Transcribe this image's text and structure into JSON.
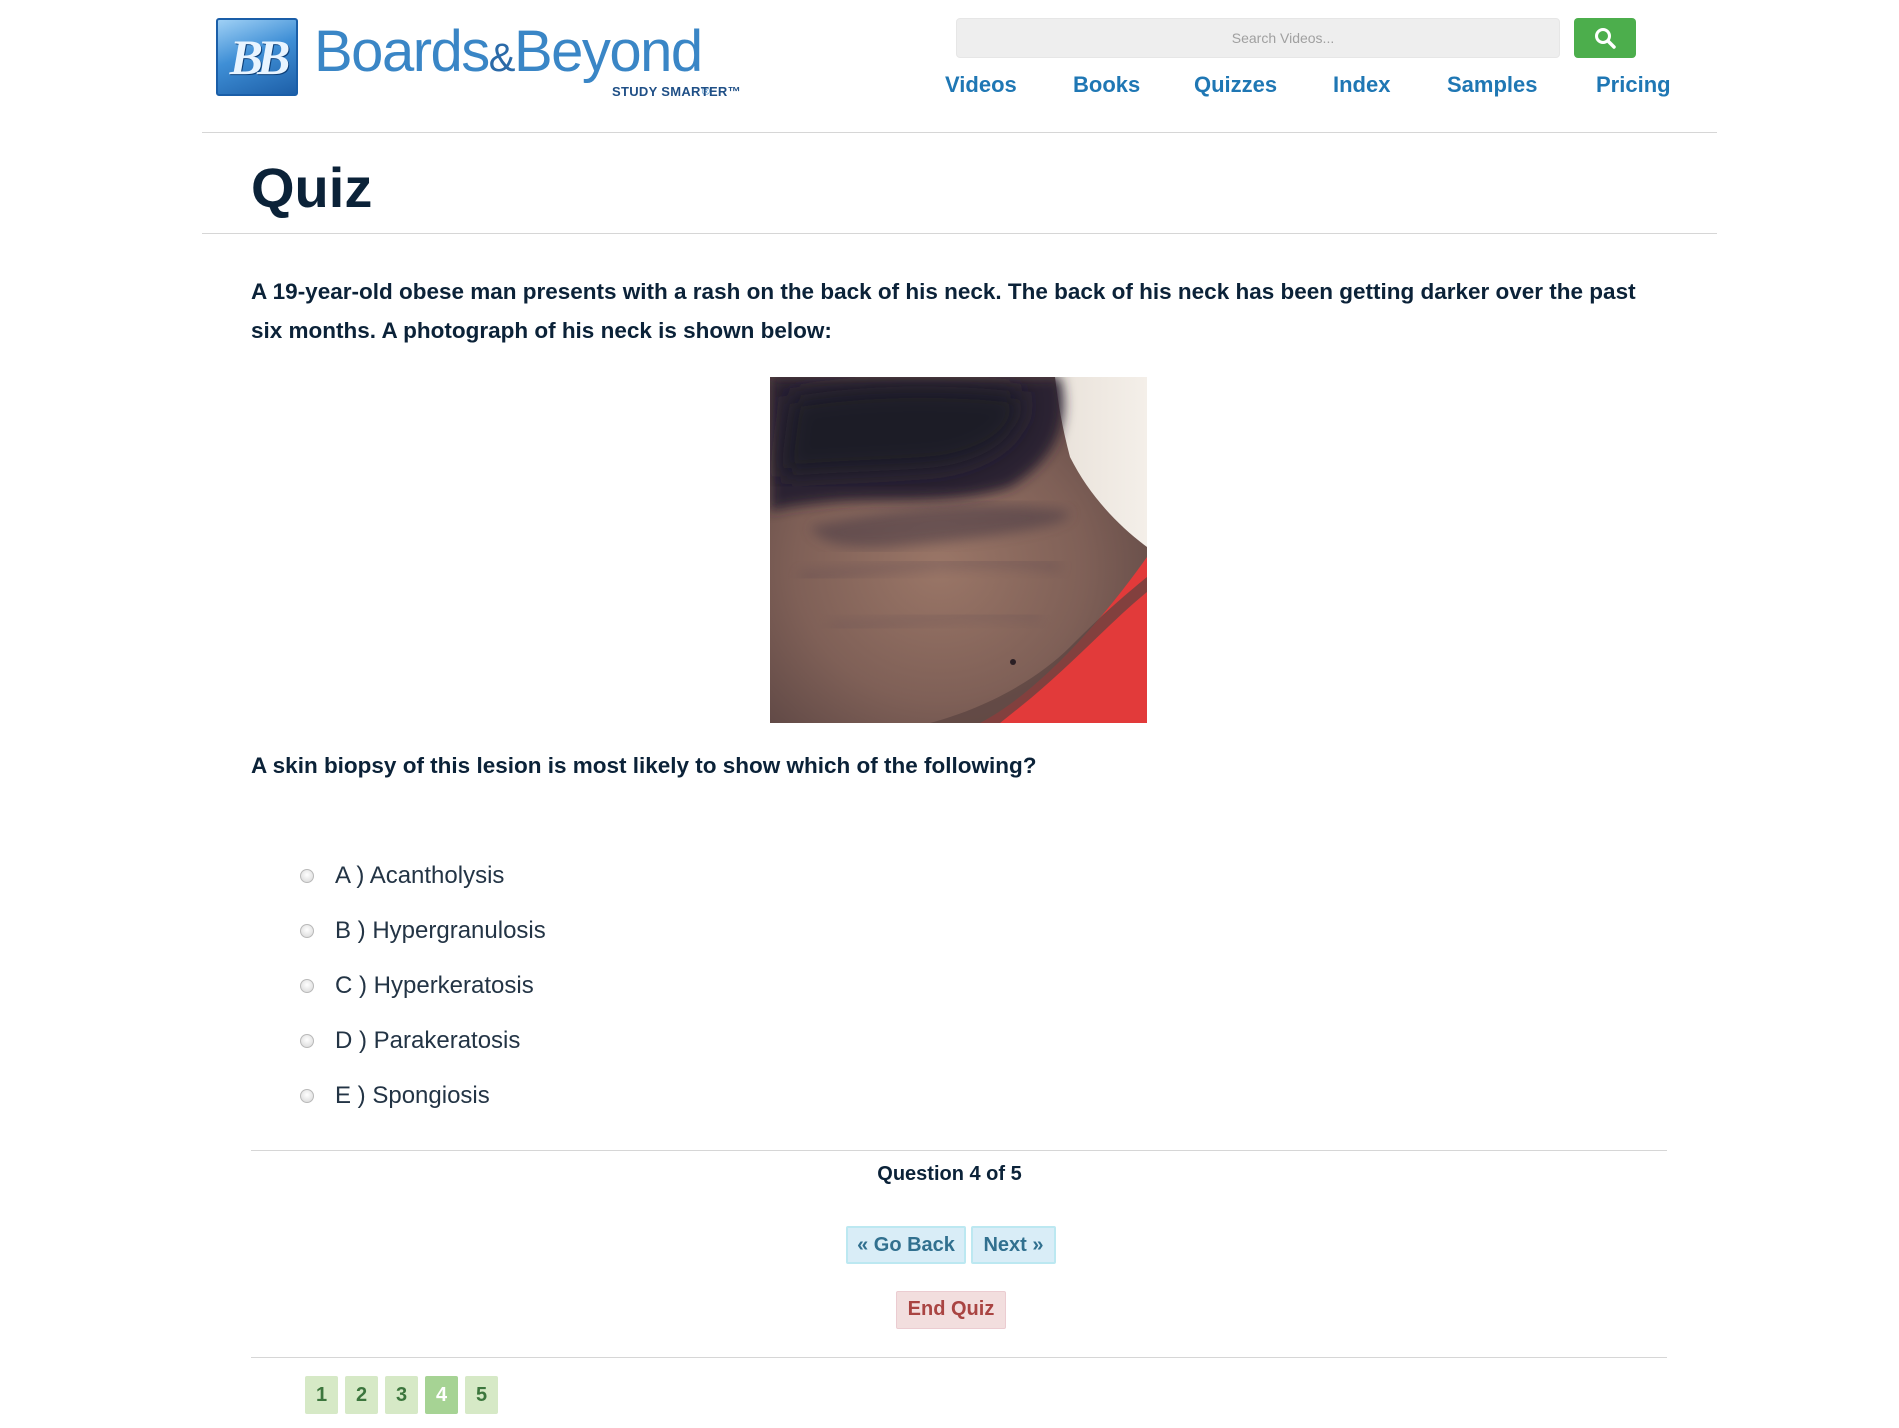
{
  "brand": {
    "mark": "BB",
    "name_part1": "Boards",
    "name_amp": "&",
    "name_part2": "Beyond",
    "registered": "®",
    "tagline": "STUDY SMARTER™"
  },
  "search": {
    "placeholder": "Search Videos..."
  },
  "nav": {
    "items": [
      "Videos",
      "Books",
      "Quizzes",
      "Index",
      "Samples",
      "Pricing"
    ]
  },
  "page": {
    "title": "Quiz"
  },
  "quiz": {
    "stem": "A 19-year-old obese man presents with a rash on the back of his neck. The back of his neck has been getting darker over the past six months. A photograph of his neck is shown below:",
    "prompt": "A skin biopsy of this lesion is most likely to show which of the following?",
    "options": [
      {
        "letter": "A",
        "text": "A ) Acantholysis"
      },
      {
        "letter": "B",
        "text": "B ) Hypergranulosis"
      },
      {
        "letter": "C",
        "text": "C ) Hyperkeratosis"
      },
      {
        "letter": "D",
        "text": "D ) Parakeratosis"
      },
      {
        "letter": "E",
        "text": "E ) Spongiosis"
      }
    ],
    "progress_text": "Question 4 of 5",
    "back_label": "« Go Back",
    "next_label": "Next »",
    "end_label": "End Quiz",
    "pages": [
      "1",
      "2",
      "3",
      "4",
      "5"
    ],
    "current_page": "4"
  },
  "colors": {
    "link": "#1f77b4",
    "search_button": "#4cae4c",
    "nav_button_bg": "#d9edf7",
    "end_button_bg": "#f2dede",
    "pager_bg": "#d6e9c6",
    "pager_active": "#a6d394"
  }
}
